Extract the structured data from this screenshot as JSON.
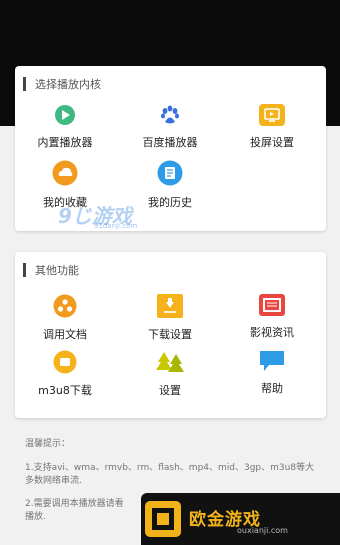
{
  "section_player": {
    "title": "选择播放内核",
    "items": [
      {
        "label": "内置播放器",
        "icon": "play-circle-icon"
      },
      {
        "label": "百度播放器",
        "icon": "baidu-paw-icon"
      },
      {
        "label": "投屏设置",
        "icon": "cast-screen-icon"
      },
      {
        "label": "我的收藏",
        "icon": "cloud-favorite-icon"
      },
      {
        "label": "我的历史",
        "icon": "history-note-icon"
      }
    ]
  },
  "section_other": {
    "title": "其他功能",
    "items": [
      {
        "label": "调用文档",
        "icon": "share-nodes-icon"
      },
      {
        "label": "下载设置",
        "icon": "download-icon"
      },
      {
        "label": "影视资讯",
        "icon": "film-news-icon"
      },
      {
        "label": "m3u8下载",
        "icon": "m3u8-icon"
      },
      {
        "label": "设置",
        "icon": "tree-settings-icon"
      },
      {
        "label": "帮助",
        "icon": "chat-help-icon"
      }
    ]
  },
  "tips": {
    "title": "温馨提示：",
    "line1": "1.支持avi、wma、rmvb、rm、flash、mp4、mid、3gp、m3u8等大多数网络串流.",
    "line2": "2.需要调用本播放器请看",
    "line2b": "播放."
  },
  "watermarks": {
    "wm1_text": "9じ游戏",
    "wm1_url": "91danji.com",
    "wm2_text": "欧金游戏",
    "wm2_url": "ouxianji.com"
  },
  "colors": {
    "accent_green": "#3fb984",
    "accent_blue": "#3a6fdc",
    "accent_yellow": "#f5b21b",
    "accent_orange": "#f29a1f",
    "accent_red": "#e8463e",
    "accent_sky": "#2e9be6"
  }
}
